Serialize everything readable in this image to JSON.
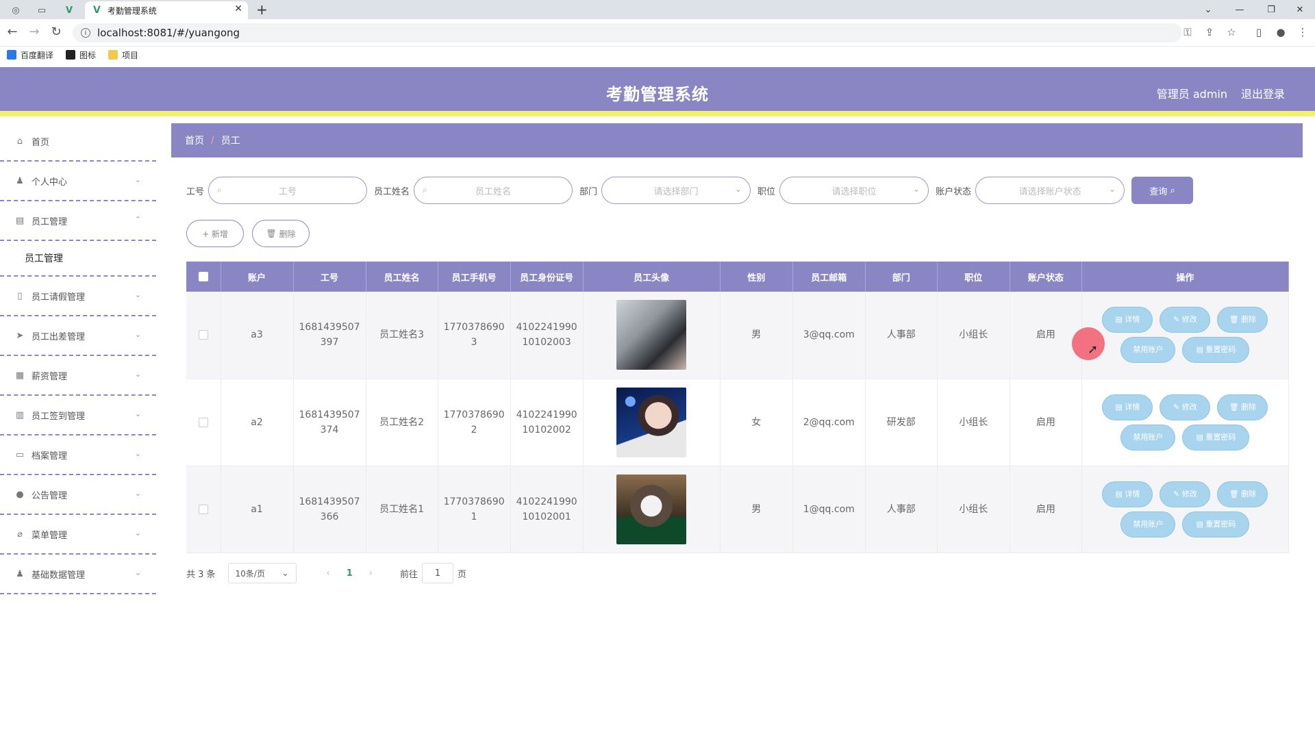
{
  "browser": {
    "tab_title": "考勤管理系统",
    "url": "localhost:8081/#/yuangong",
    "bookmarks": [
      "百度翻译",
      "图标",
      "项目"
    ]
  },
  "header": {
    "title": "考勤管理系统",
    "user": "管理员 admin",
    "logout": "退出登录"
  },
  "sidebar": {
    "items": [
      {
        "label": "首页"
      },
      {
        "label": "个人中心"
      },
      {
        "label": "员工管理"
      },
      {
        "label": "员工管理"
      },
      {
        "label": "员工请假管理"
      },
      {
        "label": "员工出差管理"
      },
      {
        "label": "薪资管理"
      },
      {
        "label": "员工签到管理"
      },
      {
        "label": "档案管理"
      },
      {
        "label": "公告管理"
      },
      {
        "label": "菜单管理"
      },
      {
        "label": "基础数据管理"
      }
    ]
  },
  "breadcrumb": {
    "home": "首页",
    "sep": "/",
    "current": "员工"
  },
  "filters": {
    "gonghao_label": "工号",
    "gonghao_placeholder": "工号",
    "name_label": "员工姓名",
    "name_placeholder": "员工姓名",
    "dept_label": "部门",
    "dept_placeholder": "请选择部门",
    "pos_label": "职位",
    "pos_placeholder": "请选择职位",
    "status_label": "账户状态",
    "status_placeholder": "请选择账户状态",
    "query": "查询"
  },
  "actions": {
    "add": "+ 新增",
    "delete": "删除"
  },
  "table": {
    "headers": [
      "账户",
      "工号",
      "员工姓名",
      "员工手机号",
      "员工身份证号",
      "员工头像",
      "性别",
      "员工邮箱",
      "部门",
      "职位",
      "账户状态",
      "操作"
    ],
    "rows": [
      {
        "account": "a3",
        "gonghao1": "1681439507",
        "gonghao2": "397",
        "name": "员工姓名3",
        "phone1": "1770378690",
        "phone2": "3",
        "id1": "4102241990",
        "id2": "10102003",
        "gender": "男",
        "email": "3@qq.com",
        "dept": "人事部",
        "position": "小组长",
        "status": "启用"
      },
      {
        "account": "a2",
        "gonghao1": "1681439507",
        "gonghao2": "374",
        "name": "员工姓名2",
        "phone1": "1770378690",
        "phone2": "2",
        "id1": "4102241990",
        "id2": "10102002",
        "gender": "女",
        "email": "2@qq.com",
        "dept": "研发部",
        "position": "小组长",
        "status": "启用"
      },
      {
        "account": "a1",
        "gonghao1": "1681439507",
        "gonghao2": "366",
        "name": "员工姓名1",
        "phone1": "1770378690",
        "phone2": "1",
        "id1": "4102241990",
        "id2": "10102001",
        "gender": "男",
        "email": "1@qq.com",
        "dept": "人事部",
        "position": "小组长",
        "status": "启用"
      }
    ],
    "op": {
      "detail": "详情",
      "edit": "修改",
      "del": "删除",
      "disable": "禁用账户",
      "reset": "重置密码"
    }
  },
  "pager": {
    "total": "共 3 条",
    "size": "10条/页",
    "page": "1",
    "goto": "前往",
    "goto_val": "1",
    "page_unit": "页"
  },
  "colors": {
    "primary": "#8a86c4",
    "accent_bar": "#f3f06a",
    "op_button": "#a8d4ee"
  }
}
